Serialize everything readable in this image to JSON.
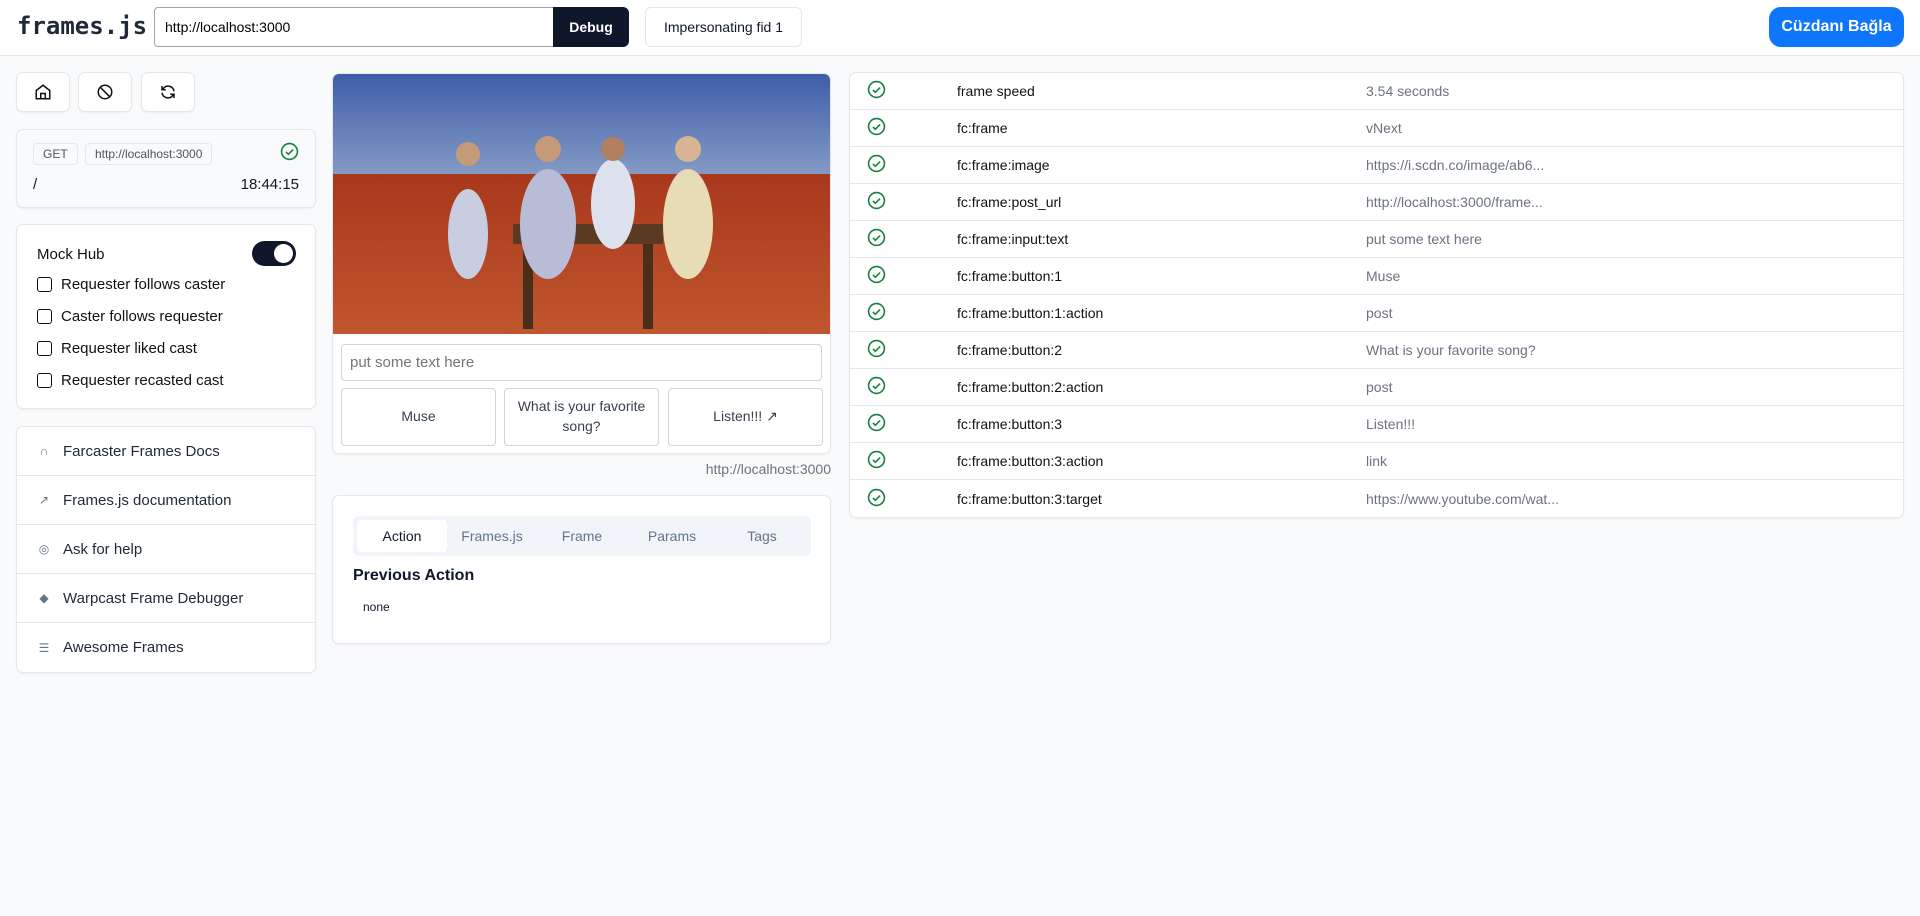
{
  "header": {
    "logo": "frames.js",
    "url_value": "http://localhost:3000",
    "debug_label": "Debug",
    "impersonate_label": "Impersonating fid 1",
    "wallet_label": "Cüzdanı Bağla"
  },
  "request": {
    "method": "GET",
    "host": "http://localhost:3000",
    "path": "/",
    "time": "18:44:15",
    "status": "success"
  },
  "mock_hub": {
    "label": "Mock Hub",
    "enabled": true,
    "options": [
      {
        "label": "Requester follows caster",
        "checked": false
      },
      {
        "label": "Caster follows requester",
        "checked": false
      },
      {
        "label": "Requester liked cast",
        "checked": false
      },
      {
        "label": "Requester recasted cast",
        "checked": false
      }
    ]
  },
  "links": [
    {
      "label": "Farcaster Frames Docs",
      "icon": "farcaster-icon"
    },
    {
      "label": "Frames.js documentation",
      "icon": "external-link-icon"
    },
    {
      "label": "Ask for help",
      "icon": "chat-icon"
    },
    {
      "label": "Warpcast Frame Debugger",
      "icon": "diamond-icon"
    },
    {
      "label": "Awesome Frames",
      "icon": "list-icon"
    }
  ],
  "frame": {
    "input_placeholder": "put some text here",
    "buttons": [
      "Muse",
      "What is your favorite song?",
      "Listen!!! ↗"
    ],
    "host": "http://localhost:3000"
  },
  "tabs": {
    "items": [
      "Action",
      "Frames.js",
      "Frame",
      "Params",
      "Tags"
    ],
    "active": "Action",
    "heading": "Previous Action",
    "content": "none"
  },
  "meta": [
    {
      "key": "frame speed",
      "value": "3.54 seconds"
    },
    {
      "key": "fc:frame",
      "value": "vNext"
    },
    {
      "key": "fc:frame:image",
      "value": "https://i.scdn.co/image/ab6..."
    },
    {
      "key": "fc:frame:post_url",
      "value": "http://localhost:3000/frame..."
    },
    {
      "key": "fc:frame:input:text",
      "value": "put some text here"
    },
    {
      "key": "fc:frame:button:1",
      "value": "Muse"
    },
    {
      "key": "fc:frame:button:1:action",
      "value": "post"
    },
    {
      "key": "fc:frame:button:2",
      "value": "What is your favorite song?"
    },
    {
      "key": "fc:frame:button:2:action",
      "value": "post"
    },
    {
      "key": "fc:frame:button:3",
      "value": "Listen!!!"
    },
    {
      "key": "fc:frame:button:3:action",
      "value": "link"
    },
    {
      "key": "fc:frame:button:3:target",
      "value": "https://www.youtube.com/wat..."
    }
  ],
  "colors": {
    "accent": "#0e76fd",
    "dark": "#0f172a",
    "success": "#15803d"
  }
}
